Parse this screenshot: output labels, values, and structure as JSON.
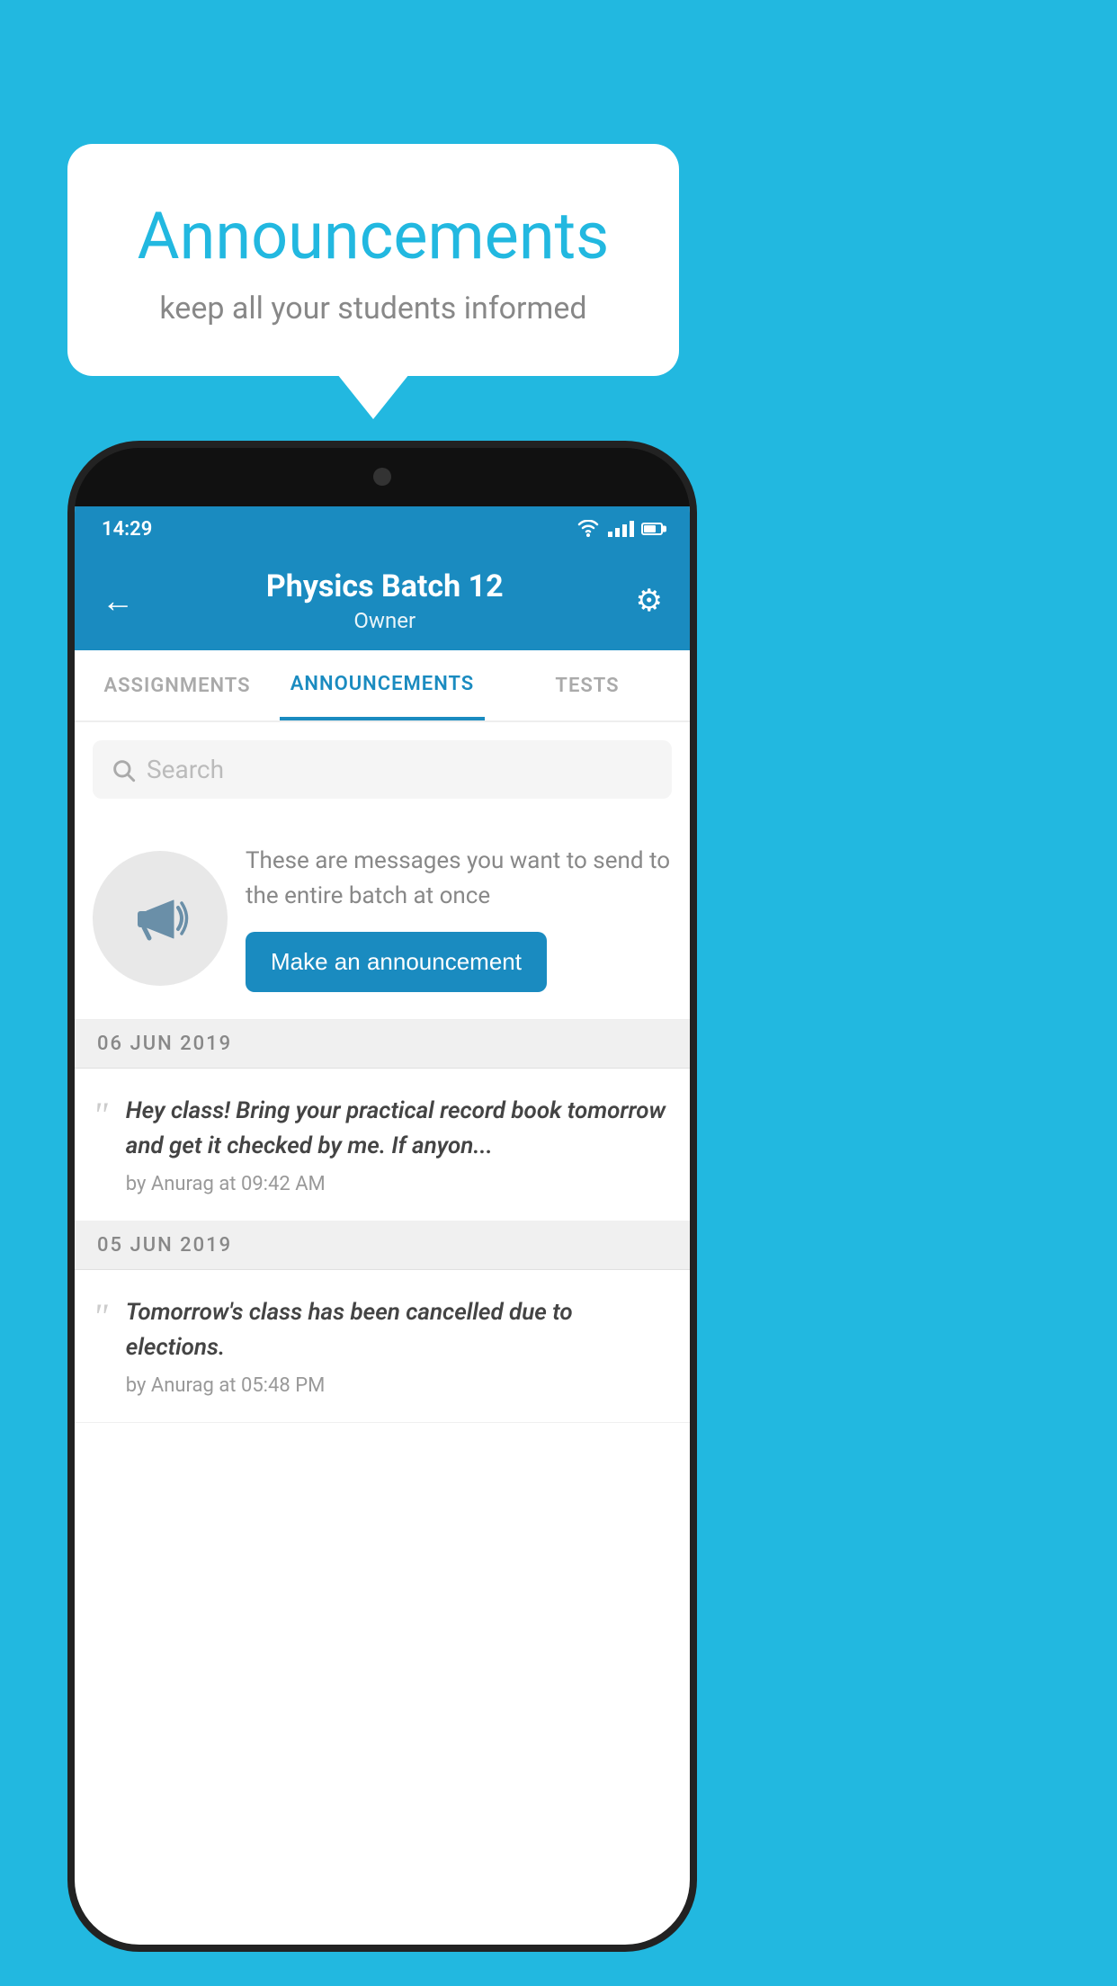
{
  "background_color": "#22B8E0",
  "speech_bubble": {
    "title": "Announcements",
    "subtitle": "keep all your students informed"
  },
  "phone": {
    "status_bar": {
      "time": "14:29"
    },
    "header": {
      "title": "Physics Batch 12",
      "subtitle": "Owner",
      "back_label": "←",
      "gear_label": "⚙"
    },
    "tabs": [
      {
        "label": "ASSIGNMENTS",
        "active": false
      },
      {
        "label": "ANNOUNCEMENTS",
        "active": true
      },
      {
        "label": "TESTS",
        "active": false
      }
    ],
    "search": {
      "placeholder": "Search"
    },
    "promo": {
      "description": "These are messages you want to send to the entire batch at once",
      "button_label": "Make an announcement"
    },
    "announcements": [
      {
        "date": "06  JUN  2019",
        "text": "Hey class! Bring your practical record book tomorrow and get it checked by me. If anyon...",
        "author": "by Anurag at 09:42 AM"
      },
      {
        "date": "05  JUN  2019",
        "text": "Tomorrow's class has been cancelled due to elections.",
        "author": "by Anurag at 05:48 PM"
      }
    ]
  }
}
